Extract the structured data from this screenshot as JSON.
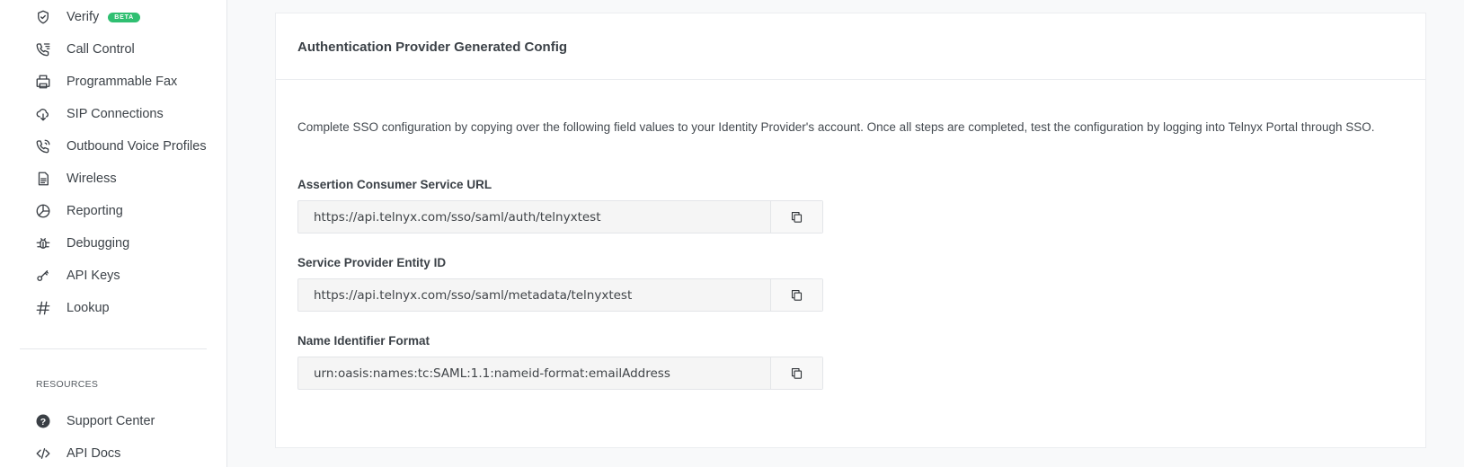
{
  "sidebar": {
    "items": [
      {
        "label": "Verify",
        "icon": "shield-check-icon",
        "badge": "BETA"
      },
      {
        "label": "Call Control",
        "icon": "phone-list-icon"
      },
      {
        "label": "Programmable Fax",
        "icon": "fax-icon"
      },
      {
        "label": "SIP Connections",
        "icon": "cloud-connection-icon"
      },
      {
        "label": "Outbound Voice Profiles",
        "icon": "phone-outgoing-icon"
      },
      {
        "label": "Wireless",
        "icon": "sim-card-icon"
      },
      {
        "label": "Reporting",
        "icon": "pie-chart-icon"
      },
      {
        "label": "Debugging",
        "icon": "bug-icon"
      },
      {
        "label": "API Keys",
        "icon": "key-icon"
      },
      {
        "label": "Lookup",
        "icon": "hash-icon"
      }
    ],
    "resources_heading": "RESOURCES",
    "resources": [
      {
        "label": "Support Center",
        "icon": "help-circle-icon"
      },
      {
        "label": "API Docs",
        "icon": "code-icon"
      }
    ]
  },
  "config": {
    "title": "Authentication Provider Generated Config",
    "description": "Complete SSO configuration by copying over the following field values to your Identity Provider's account. Once all steps are completed, test the configuration by logging into Telnyx Portal through SSO.",
    "fields": [
      {
        "label": "Assertion Consumer Service URL",
        "value": "https://api.telnyx.com/sso/saml/auth/telnyxtest"
      },
      {
        "label": "Service Provider Entity ID",
        "value": "https://api.telnyx.com/sso/saml/metadata/telnyxtest"
      },
      {
        "label": "Name Identifier Format",
        "value": "urn:oasis:names:tc:SAML:1.1:nameid-format:emailAddress"
      }
    ]
  },
  "colors": {
    "badge": "#2fbf71",
    "text": "#3b4147",
    "card_border": "#ebedf0"
  }
}
